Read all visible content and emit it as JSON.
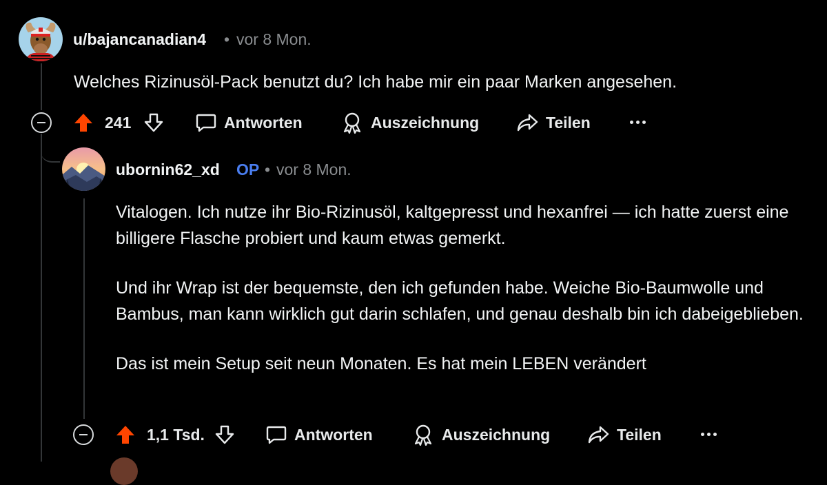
{
  "comment1": {
    "username": "u/bajancanadian4",
    "separator": "•",
    "time": "vor 8 Mon.",
    "body": "Welches Rizinusöl-Pack benutzt du? Ich habe mir ein paar Marken angesehen.",
    "vote_count": "241",
    "actions": {
      "reply": "Antworten",
      "award": "Auszeichnung",
      "share": "Teilen"
    }
  },
  "comment2": {
    "username": "ubornin62_xd",
    "op_badge": "OP",
    "separator": "•",
    "time": "vor 8 Mon.",
    "paragraphs": [
      "Vitalogen. Ich nutze ihr Bio-Rizinusöl, kaltgepresst und hexanfrei — ich hatte zuerst eine billigere Flasche probiert und kaum etwas gemerkt.",
      "Und ihr Wrap ist der bequemste, den ich gefunden habe. Weiche Bio-Baumwolle und Bambus, man kann wirklich gut darin schlafen, und genau deshalb bin ich dabeigeblieben.",
      "Das ist mein Setup seit neun Monaten. Es hat mein LEBEN verändert"
    ],
    "vote_count": "1,1 Tsd.",
    "actions": {
      "reply": "Antworten",
      "award": "Auszeichnung",
      "share": "Teilen"
    }
  },
  "colors": {
    "background": "#000000",
    "upvote": "#ff4500",
    "op": "#4a7ef0",
    "meta": "#8a8d90"
  },
  "icons": [
    "upvote-arrow-icon",
    "downvote-arrow-icon",
    "speech-bubble-icon",
    "award-ribbon-icon",
    "share-arrow-icon",
    "more-dots-icon",
    "collapse-minus-icon"
  ]
}
